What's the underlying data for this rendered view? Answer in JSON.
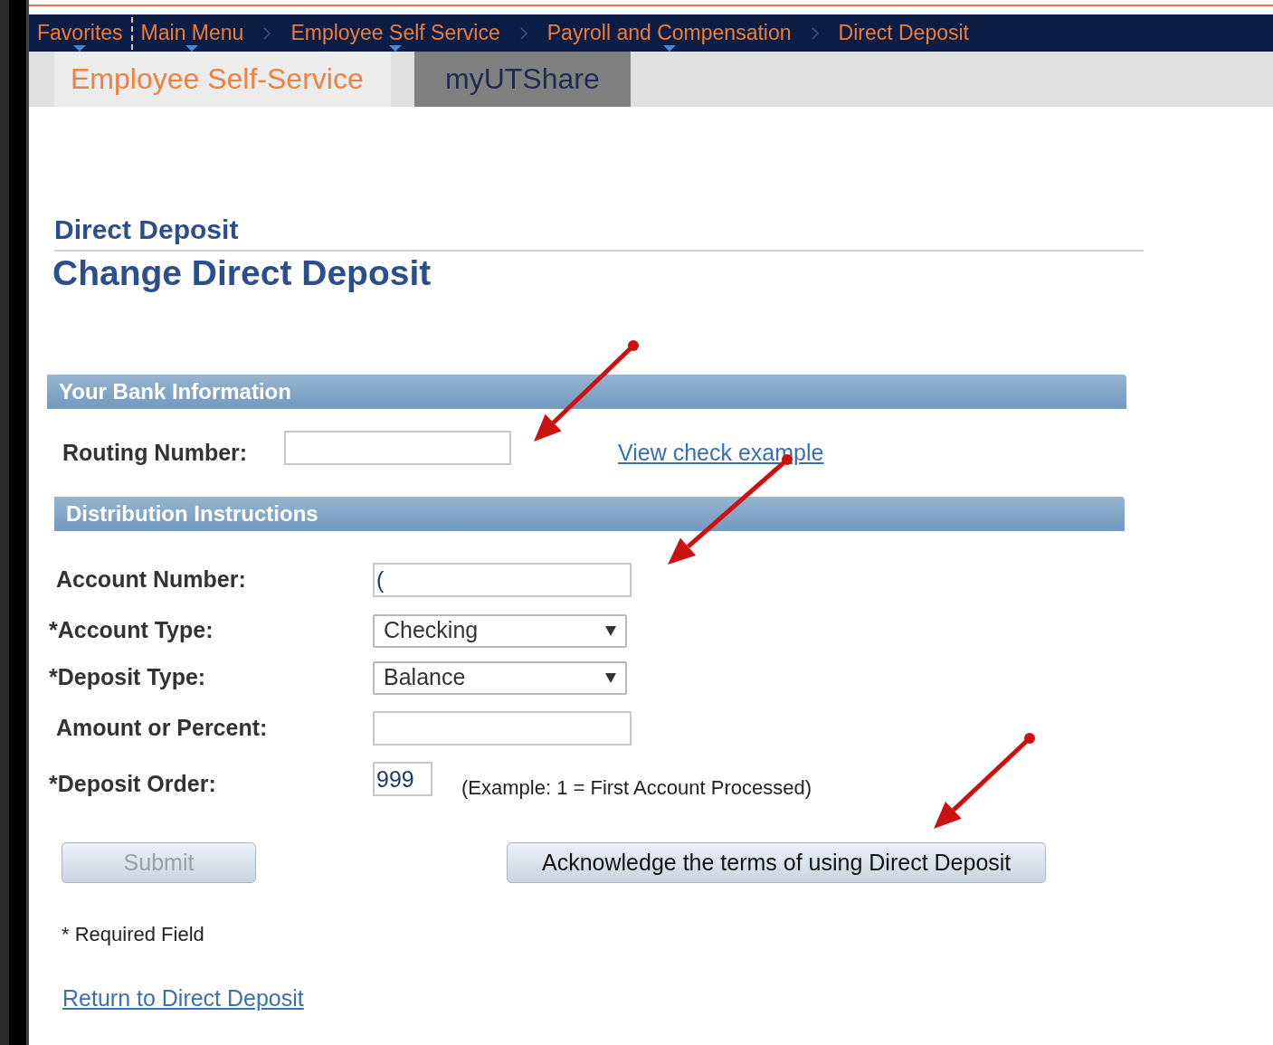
{
  "nav_bar": {
    "items": [
      {
        "label": "Favorites",
        "has_menu": true
      },
      {
        "label": "Main Menu",
        "has_menu": true
      },
      {
        "label": "Employee Self Service",
        "has_menu": true
      },
      {
        "label": "Payroll and Compensation",
        "has_menu": true
      },
      {
        "label": "Direct Deposit",
        "has_menu": false
      }
    ]
  },
  "tabs": [
    {
      "label": "Employee Self-Service",
      "selected": false
    },
    {
      "label": "myUTShare",
      "selected": true
    }
  ],
  "page_title": "Direct Deposit",
  "page_subtitle": "Change Direct Deposit",
  "bank_section": {
    "title": "Your Bank Information",
    "routing_label": "Routing Number:",
    "link": "View check example"
  },
  "distribution_section": {
    "title": "Distribution Instructions",
    "fields": [
      {
        "kind": "text",
        "label": "Account Number:",
        "value": "("
      },
      {
        "kind": "select",
        "label": "*Account Type:",
        "value": "Checking"
      },
      {
        "kind": "select",
        "label": "*Deposit Type:",
        "value": "Balance"
      },
      {
        "kind": "text",
        "label": "Amount or Percent:"
      },
      {
        "kind": "short",
        "label": "*Deposit Order:",
        "value": "999",
        "hint": "(Example: 1 = First Account Processed)"
      }
    ]
  },
  "buttons": [
    {
      "label": "Submit",
      "disabled": true
    },
    {
      "label": "Acknowledge the terms of using Direct Deposit",
      "disabled": false
    }
  ],
  "required_note": "* Required Field",
  "return_link": "Return to Direct Deposit",
  "annotations": [
    {
      "kind": "arrow"
    },
    {
      "kind": "arrow"
    },
    {
      "kind": "arrow"
    }
  ]
}
